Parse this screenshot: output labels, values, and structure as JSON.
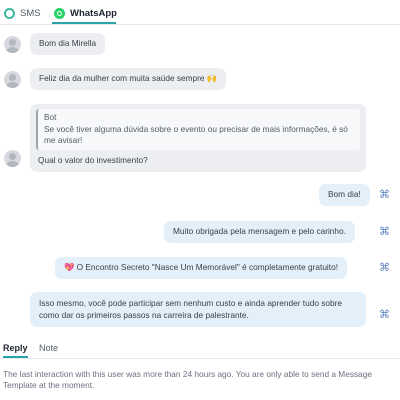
{
  "tabs": {
    "sms": "SMS",
    "whatsapp": "WhatsApp"
  },
  "messages": {
    "m1": "Bom dia Mirella",
    "m2": "Feliz dia da mulher com muita saúde sempre 🙌",
    "m3": {
      "quote_author": "Bot",
      "quote_text": "Se você tiver alguma dúvida sobre o evento ou precisar de mais informações, é só me avisar!",
      "text": "Qual o valor do investimento?"
    },
    "m4": "Bom dia!",
    "m5": "Muito obrigada pela mensagem e pelo carinho.",
    "m6": "💖 O Encontro Secreto \"Nasce Um Memorável\" é completamente gratuito!",
    "m7": "Isso mesmo, você pode participar sem nenhum custo e ainda aprender tudo sobre como dar os primeiros passos na carreira de palestrante."
  },
  "icons": {
    "agent": "agent-badge-icon",
    "avatar": "user-avatar-icon",
    "sms": "sms-channel-icon",
    "whatsapp": "whatsapp-icon"
  },
  "composer": {
    "reply_tab": "Reply",
    "note_tab": "Note",
    "notice": "The last interaction with this user was more than 24 hours ago. You are only able to send a Message Template at the moment."
  },
  "colors": {
    "accent": "#2aa3a9",
    "whatsapp": "#25d366",
    "incoming_bubble": "#eceef1",
    "outgoing_bubble": "#e3f0f9"
  }
}
